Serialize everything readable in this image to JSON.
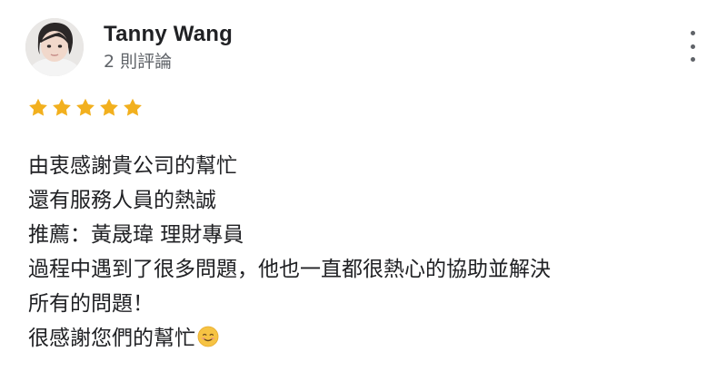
{
  "reviewer": {
    "name": "Tanny Wang",
    "review_count": "2 則評論",
    "avatar_icon": "user-photo"
  },
  "rating": {
    "stars": 5,
    "max_stars": 5,
    "star_color": "#f2b01e"
  },
  "menu": {
    "icon": "more-vertical-icon"
  },
  "review": {
    "lines": [
      "由衷感謝貴公司的幫忙",
      "還有服務人員的熱誠",
      "推薦：黃晟瑋 理財專員",
      "過程中遇到了很多問題，他也一直都很熱心的協助並解決",
      "所有的問題！",
      "很感謝您們的幫忙"
    ],
    "emoji": "smiling-face-emoji"
  }
}
